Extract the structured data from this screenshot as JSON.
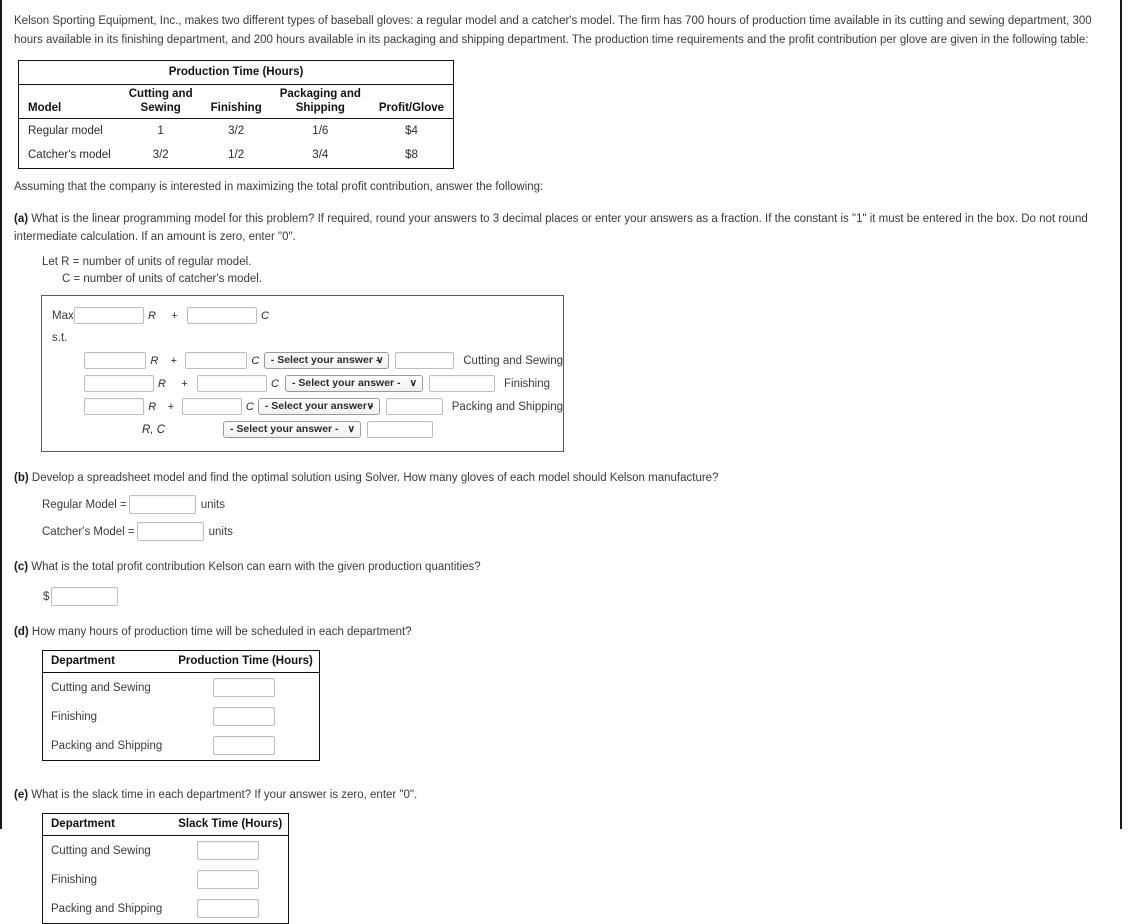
{
  "intro": "Kelson Sporting Equipment, Inc., makes two different types of baseball gloves: a regular model and a catcher's model. The firm has 700 hours of production time available in its cutting and sewing department, 300 hours available in its finishing department, and 200 hours available in its packaging and shipping department. The production time requirements and the profit contribution per glove are given in the following table:",
  "prod_table": {
    "title": "Production Time (Hours)",
    "headers": {
      "model": "Model",
      "cutting_sewing_l1": "Cutting and",
      "cutting_sewing_l2": "Sewing",
      "finishing": "Finishing",
      "packaging_shipping_l1": "Packaging and",
      "packaging_shipping_l2": "Shipping",
      "profit": "Profit/Glove"
    },
    "rows": [
      {
        "model": "Regular model",
        "cutting_sewing": "1",
        "finishing": "3/2",
        "packaging_shipping": "1/6",
        "profit": "$4"
      },
      {
        "model": "Catcher's model",
        "cutting_sewing": "3/2",
        "finishing": "1/2",
        "packaging_shipping": "3/4",
        "profit": "$8"
      }
    ]
  },
  "assume_text": "Assuming that the company is interested in maximizing the total profit contribution, answer the following:",
  "questions": {
    "a": {
      "label": "(a)",
      "text": "What is the linear programming model for this problem? If required, round your answers to 3 decimal places or enter your answers as a fraction. If the constant is \"1\" it must be entered in the box. Do not round intermediate calculation. If an amount is zero, enter \"0\".",
      "let_r": "Let R = number of units of regular model.",
      "let_c": "C = number of units of catcher's model.",
      "model_box": {
        "max_label": "Max",
        "st_label": "s.t.",
        "plus": "+",
        "var_r": "R",
        "var_c": "C",
        "rc_label": "R, C",
        "select_placeholder": "- Select your answer -",
        "caret": "∨",
        "constraints": [
          {
            "dept": "Cutting and Sewing"
          },
          {
            "dept": "Finishing"
          },
          {
            "dept": "Packing and Shipping"
          }
        ]
      }
    },
    "b": {
      "label": "(b)",
      "text": "Develop a spreadsheet model and find the optimal solution using Solver. How many gloves of each model should Kelson manufacture?",
      "rows": [
        {
          "label": "Regular Model =",
          "units": "units"
        },
        {
          "label": "Catcher's Model =",
          "units": "units"
        }
      ]
    },
    "c": {
      "label": "(c)",
      "text": "What is the total profit contribution Kelson can earn with the given production quantities?",
      "currency": "$"
    },
    "d": {
      "label": "(d)",
      "text": "How many hours of production time will be scheduled in each department?",
      "table": {
        "col_dept": "Department",
        "col_value": "Production Time (Hours)",
        "rows": [
          "Cutting and Sewing",
          "Finishing",
          "Packing and Shipping"
        ]
      }
    },
    "e": {
      "label": "(e)",
      "text": "What is the slack time in each department? If your answer is zero, enter \"0\".",
      "table": {
        "col_dept": "Department",
        "col_value": "Slack Time (Hours)",
        "rows": [
          "Cutting and Sewing",
          "Finishing",
          "Packing and Shipping"
        ]
      }
    }
  }
}
